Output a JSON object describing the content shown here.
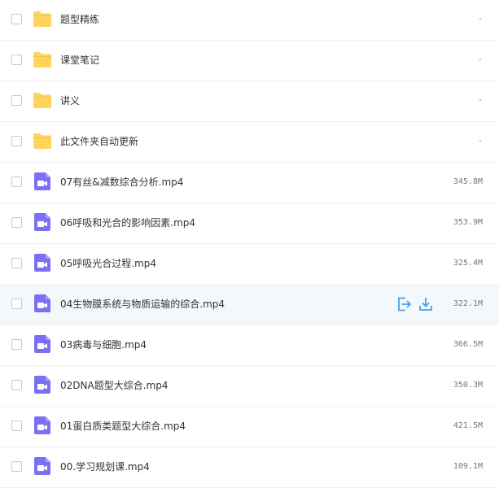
{
  "files": [
    {
      "name": "题型精练",
      "size": "-",
      "type": "folder"
    },
    {
      "name": "课堂笔记",
      "size": "-",
      "type": "folder"
    },
    {
      "name": "讲义",
      "size": "-",
      "type": "folder"
    },
    {
      "name": "此文件夹自动更新",
      "size": "-",
      "type": "folder"
    },
    {
      "name": "07有丝&减数综合分析.mp4",
      "size": "345.8M",
      "type": "video"
    },
    {
      "name": "06呼吸和光合的影响因素.mp4",
      "size": "353.9M",
      "type": "video"
    },
    {
      "name": "05呼吸光合过程.mp4",
      "size": "325.4M",
      "type": "video"
    },
    {
      "name": "04生物膜系统与物质运输的综合.mp4",
      "size": "322.1M",
      "type": "video",
      "hovered": true
    },
    {
      "name": "03病毒与细胞.mp4",
      "size": "366.5M",
      "type": "video"
    },
    {
      "name": "02DNA题型大综合.mp4",
      "size": "350.3M",
      "type": "video"
    },
    {
      "name": "01蛋白质类题型大综合.mp4",
      "size": "421.5M",
      "type": "video"
    },
    {
      "name": "00.学习规划课.mp4",
      "size": "109.1M",
      "type": "video"
    }
  ],
  "icons": {
    "folder": "folder-icon",
    "video": "video-file-icon",
    "share": "share-icon",
    "download": "download-icon"
  },
  "colors": {
    "folder": "#ffd35c",
    "video": "#7b70f4",
    "action": "#4a9ee8",
    "hover_row": "#f3f8fd"
  }
}
